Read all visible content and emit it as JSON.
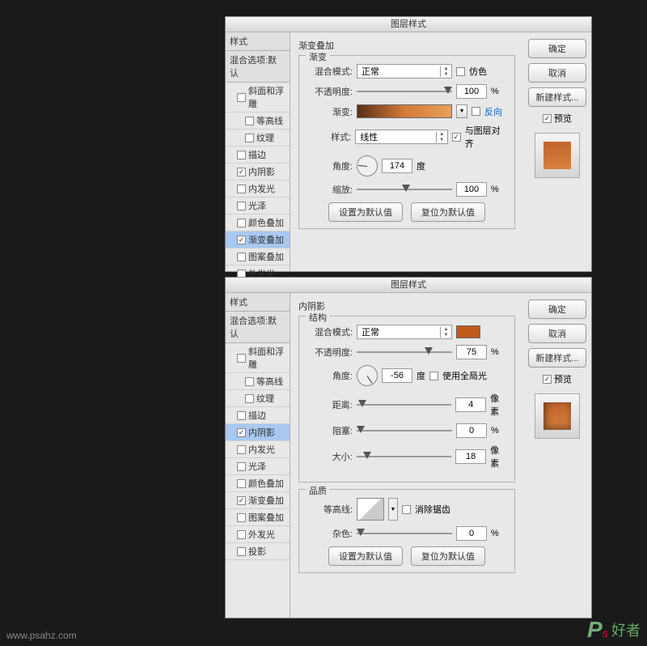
{
  "dialog_title": "图层样式",
  "sidebar": {
    "header1": "样式",
    "header2": "混合选项:默认",
    "items": [
      {
        "label": "斜面和浮雕",
        "checked": false,
        "indent": 1
      },
      {
        "label": "等高线",
        "checked": false,
        "indent": 2
      },
      {
        "label": "纹理",
        "checked": false,
        "indent": 2
      },
      {
        "label": "描边",
        "checked": false,
        "indent": 1
      },
      {
        "label": "内阴影",
        "checked": true,
        "indent": 1
      },
      {
        "label": "内发光",
        "checked": false,
        "indent": 1
      },
      {
        "label": "光泽",
        "checked": false,
        "indent": 1
      },
      {
        "label": "颜色叠加",
        "checked": false,
        "indent": 1
      },
      {
        "label": "渐变叠加",
        "checked": true,
        "indent": 1
      },
      {
        "label": "图案叠加",
        "checked": false,
        "indent": 1
      },
      {
        "label": "外发光",
        "checked": false,
        "indent": 1
      },
      {
        "label": "投影",
        "checked": false,
        "indent": 1
      }
    ]
  },
  "right": {
    "ok": "确定",
    "cancel": "取消",
    "newstyle": "新建样式...",
    "preview": "预览"
  },
  "buttons": {
    "set_default": "设置为默认值",
    "reset_default": "复位为默认值"
  },
  "panel1": {
    "title": "渐变叠加",
    "group": "渐变",
    "blend_label": "混合模式:",
    "blend_value": "正常",
    "dither": "仿色",
    "opacity_label": "不透明度:",
    "opacity_value": "100",
    "percent": "%",
    "gradient_label": "渐变:",
    "reverse": "反向",
    "style_label": "样式:",
    "style_value": "线性",
    "align": "与图层对齐",
    "angle_label": "角度:",
    "angle_value": "174",
    "degree": "度",
    "scale_label": "缩放:",
    "scale_value": "100"
  },
  "panel2": {
    "title": "内阴影",
    "group1": "结构",
    "blend_label": "混合模式:",
    "blend_value": "正常",
    "opacity_label": "不透明度:",
    "opacity_value": "75",
    "percent": "%",
    "angle_label": "角度:",
    "angle_value": "-56",
    "degree": "度",
    "global": "使用全局光",
    "distance_label": "距离:",
    "distance_value": "4",
    "px": "像素",
    "choke_label": "阻塞:",
    "choke_value": "0",
    "size_label": "大小:",
    "size_value": "18",
    "group2": "品质",
    "contour_label": "等高线:",
    "antialias": "消除锯齿",
    "noise_label": "杂色:",
    "noise_value": "0"
  },
  "watermark": {
    "url": "www.psahz.com",
    "text": "好者"
  }
}
